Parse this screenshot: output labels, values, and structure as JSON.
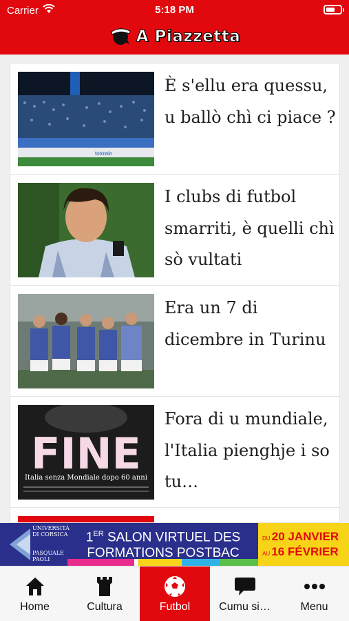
{
  "status_bar": {
    "carrier": "Carrier",
    "time": "5:18 PM"
  },
  "header": {
    "title": "A Piazzetta",
    "logo_icon": "moor-head-icon"
  },
  "articles": [
    {
      "title": "È s'ellu era quessu, u ballò chì ci piace ?",
      "thumb_icon": "stadium-crowd-photo"
    },
    {
      "title": "I clubs di futbol smarriti, è quelli chì sò vultati",
      "thumb_icon": "footballer-portrait-photo"
    },
    {
      "title": "Era un 7 di dicembre in Turinu",
      "thumb_icon": "team-celebration-photo"
    },
    {
      "title": "Fora di u mundiale, l'Italia pienghje i so tu…",
      "thumb_icon": "newspaper-front-photo"
    }
  ],
  "thumb_text": {
    "stadium_board": "totowin",
    "fine_headline": "FINE",
    "fine_sub": "Italia senza Mondiale dopo 60 anni"
  },
  "ad": {
    "university_lines": [
      "UNIVERSITÀ",
      "DI CORSICA"
    ],
    "pasquale_lines": [
      "PASQUALE",
      "PAOLI"
    ],
    "line1_prefix": "1",
    "line1_sup": "ER",
    "line1_rest": " SALON VIRTUEL DES",
    "line2": "FORMATIONS POSTBAC",
    "date1_small": "DU ",
    "date1": "20 JANVIER",
    "date2_small": "AU ",
    "date2": "16 FÉVRIER"
  },
  "tabs": [
    {
      "label": "Home",
      "icon": "house-icon",
      "active": false
    },
    {
      "label": "Cultura",
      "icon": "tower-icon",
      "active": false
    },
    {
      "label": "Futbol",
      "icon": "soccer-ball-icon",
      "active": true
    },
    {
      "label": "Cumu si…",
      "icon": "speech-bubble-icon",
      "active": false
    },
    {
      "label": "Menu",
      "icon": "more-dots-icon",
      "active": false
    }
  ],
  "colors": {
    "brand_red": "#e1090e",
    "ad_blue": "#2a2f8c",
    "ad_yellow": "#f7d417"
  }
}
